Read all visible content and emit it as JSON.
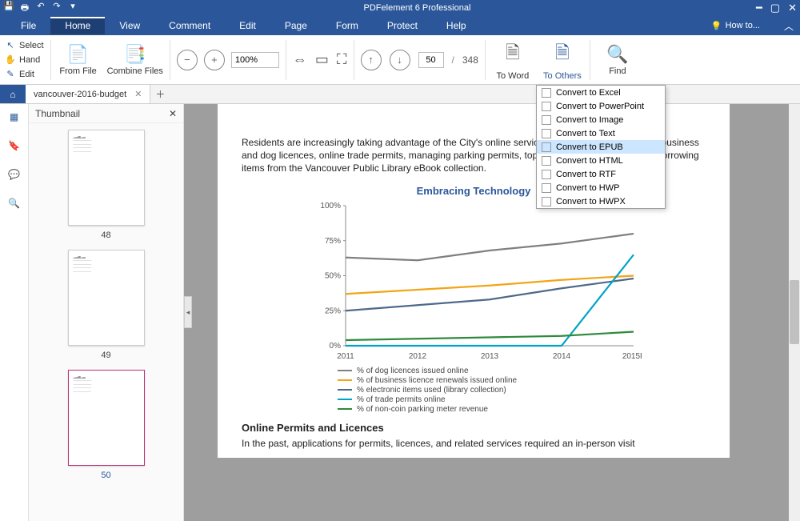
{
  "app_title": "PDFelement 6 Professional",
  "howto": "How to...",
  "menus": [
    "File",
    "Home",
    "View",
    "Comment",
    "Edit",
    "Page",
    "Form",
    "Protect",
    "Help"
  ],
  "active_menu": "Home",
  "tools_left": {
    "select": "Select",
    "hand": "Hand",
    "edit": "Edit"
  },
  "tools_from": {
    "from_file": "From File",
    "combine": "Combine Files"
  },
  "zoom_value": "100%",
  "page_current": "50",
  "page_total": "348",
  "to_word": "To Word",
  "to_others": "To Others",
  "find": "Find",
  "doc_tab": "vancouver-2016-budget",
  "thumb_header": "Thumbnail",
  "thumbs": [
    {
      "page": "48",
      "sel": false
    },
    {
      "page": "49",
      "sel": false
    },
    {
      "page": "50",
      "sel": true
    }
  ],
  "doc_body_p1": "Residents are increasingly taking advantage of the City's online services, for example, renewals of business and dog licences, online trade permits, managing parking permits, topping up parking meters and borrowing items from the Vancouver Public Library eBook collection.",
  "doc_heading2": "Online Permits and Licences",
  "doc_body_p2": "In the past, applications for permits, licences, and related services required an in-person visit",
  "chart_data": {
    "type": "line",
    "title": "Embracing Technology",
    "xlabel": "",
    "ylabel": "",
    "categories": [
      "2011",
      "2012",
      "2013",
      "2014",
      "2015F"
    ],
    "yticks": [
      "0%",
      "25%",
      "50%",
      "75%",
      "100%"
    ],
    "ylim": [
      0,
      100
    ],
    "series": [
      {
        "name": "% of dog licences issued online",
        "color": "#808080",
        "values": [
          63,
          61,
          68,
          73,
          80
        ]
      },
      {
        "name": "% of business licence renewals issued online",
        "color": "#f2a516",
        "values": [
          37,
          40,
          43,
          47,
          50
        ]
      },
      {
        "name": "% electronic items used (library collection)",
        "color": "#4e6a8a",
        "values": [
          25,
          29,
          33,
          41,
          48
        ]
      },
      {
        "name": "% of trade permits online",
        "color": "#00a3c7",
        "values": [
          0,
          0,
          0,
          0,
          65
        ]
      },
      {
        "name": "% of non-coin parking meter revenue",
        "color": "#2f8a3c",
        "values": [
          4,
          5,
          6,
          7,
          10
        ]
      }
    ]
  },
  "convert_items": [
    "Convert to Excel",
    "Convert to PowerPoint",
    "Convert to Image",
    "Convert to Text",
    "Convert to EPUB",
    "Convert to HTML",
    "Convert to RTF",
    "Convert to HWP",
    "Convert to HWPX"
  ],
  "convert_sel": 4
}
